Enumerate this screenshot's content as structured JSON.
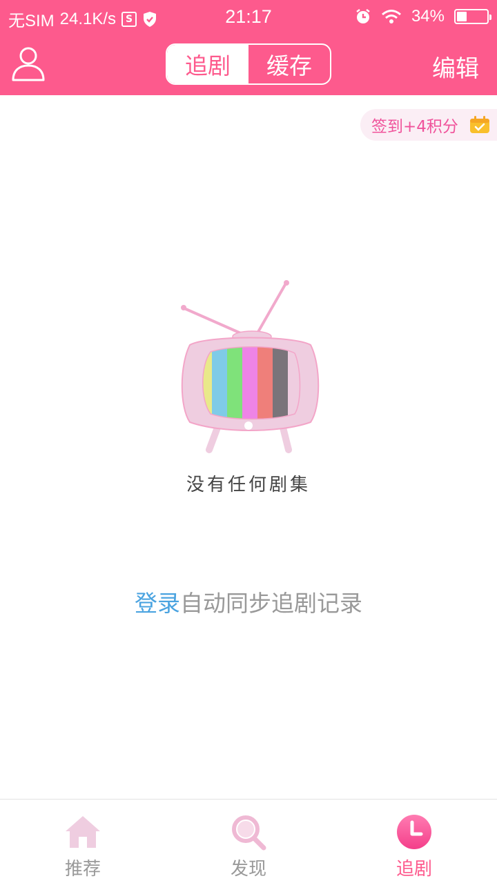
{
  "status_bar": {
    "carrier": "无SIM",
    "net_speed": "24.1K/s",
    "time": "21:17",
    "battery_pct": "34%",
    "battery_level": 0.34
  },
  "header": {
    "tabs": [
      {
        "label": "追剧",
        "active": true
      },
      {
        "label": "缓存",
        "active": false
      }
    ],
    "edit_label": "编辑"
  },
  "checkin": {
    "label": "签到+4积分"
  },
  "empty_state": {
    "text": "没有任何剧集",
    "login_link": "登录",
    "login_suffix": "自动同步追剧记录"
  },
  "bottom_nav": [
    {
      "label": "推荐",
      "icon": "home-icon",
      "active": false
    },
    {
      "label": "发现",
      "icon": "search-icon",
      "active": false
    },
    {
      "label": "追剧",
      "icon": "clock-icon",
      "active": true
    }
  ],
  "colors": {
    "brand": "#fd5a8d",
    "link": "#4aa3e0"
  }
}
